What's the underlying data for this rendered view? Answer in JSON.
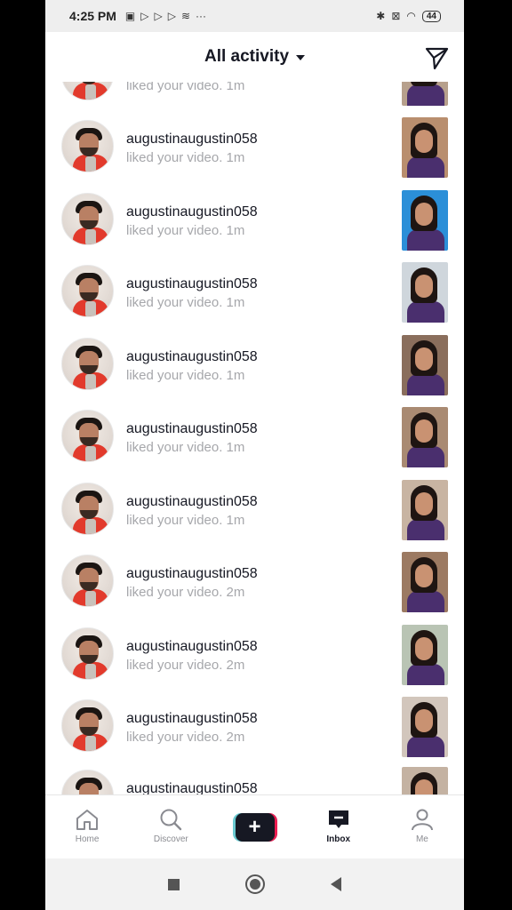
{
  "status_bar": {
    "time": "4:25 PM",
    "left_icons": [
      "notification-icon",
      "play-icon",
      "play-icon",
      "play-icon",
      "app-icon"
    ],
    "more": "···",
    "battery": "44"
  },
  "header": {
    "title": "All activity",
    "send_icon": "send-icon"
  },
  "partial_top": {
    "subtext": "liked your video. 1m"
  },
  "notifications": [
    {
      "username": "augustinaugustin058",
      "subtext": "liked your video. 1m",
      "thumb_color": "#b98e6e"
    },
    {
      "username": "augustinaugustin058",
      "subtext": "liked your video. 1m",
      "thumb_color": "#2b8fd8"
    },
    {
      "username": "augustinaugustin058",
      "subtext": "liked your video. 1m",
      "thumb_color": "#cfd6dc"
    },
    {
      "username": "augustinaugustin058",
      "subtext": "liked your video. 1m",
      "thumb_color": "#8a6e5c"
    },
    {
      "username": "augustinaugustin058",
      "subtext": "liked your video. 1m",
      "thumb_color": "#a98a72"
    },
    {
      "username": "augustinaugustin058",
      "subtext": "liked your video. 1m",
      "thumb_color": "#c8b4a2"
    },
    {
      "username": "augustinaugustin058",
      "subtext": "liked your video. 2m",
      "thumb_color": "#9c7a62"
    },
    {
      "username": "augustinaugustin058",
      "subtext": "liked your video. 2m",
      "thumb_color": "#b9c4b4"
    },
    {
      "username": "augustinaugustin058",
      "subtext": "liked your video. 2m",
      "thumb_color": "#d2c6bc"
    }
  ],
  "partial_bottom": {
    "username": "augustinaugustin058"
  },
  "bottom_nav": [
    {
      "label": "Home",
      "icon": "home-icon"
    },
    {
      "label": "Discover",
      "icon": "search-icon"
    },
    {
      "label": "",
      "icon": "plus-icon"
    },
    {
      "label": "Inbox",
      "icon": "inbox-icon"
    },
    {
      "label": "Me",
      "icon": "profile-icon"
    }
  ],
  "system_nav": [
    "recents-icon",
    "home-circle-icon",
    "back-icon"
  ]
}
